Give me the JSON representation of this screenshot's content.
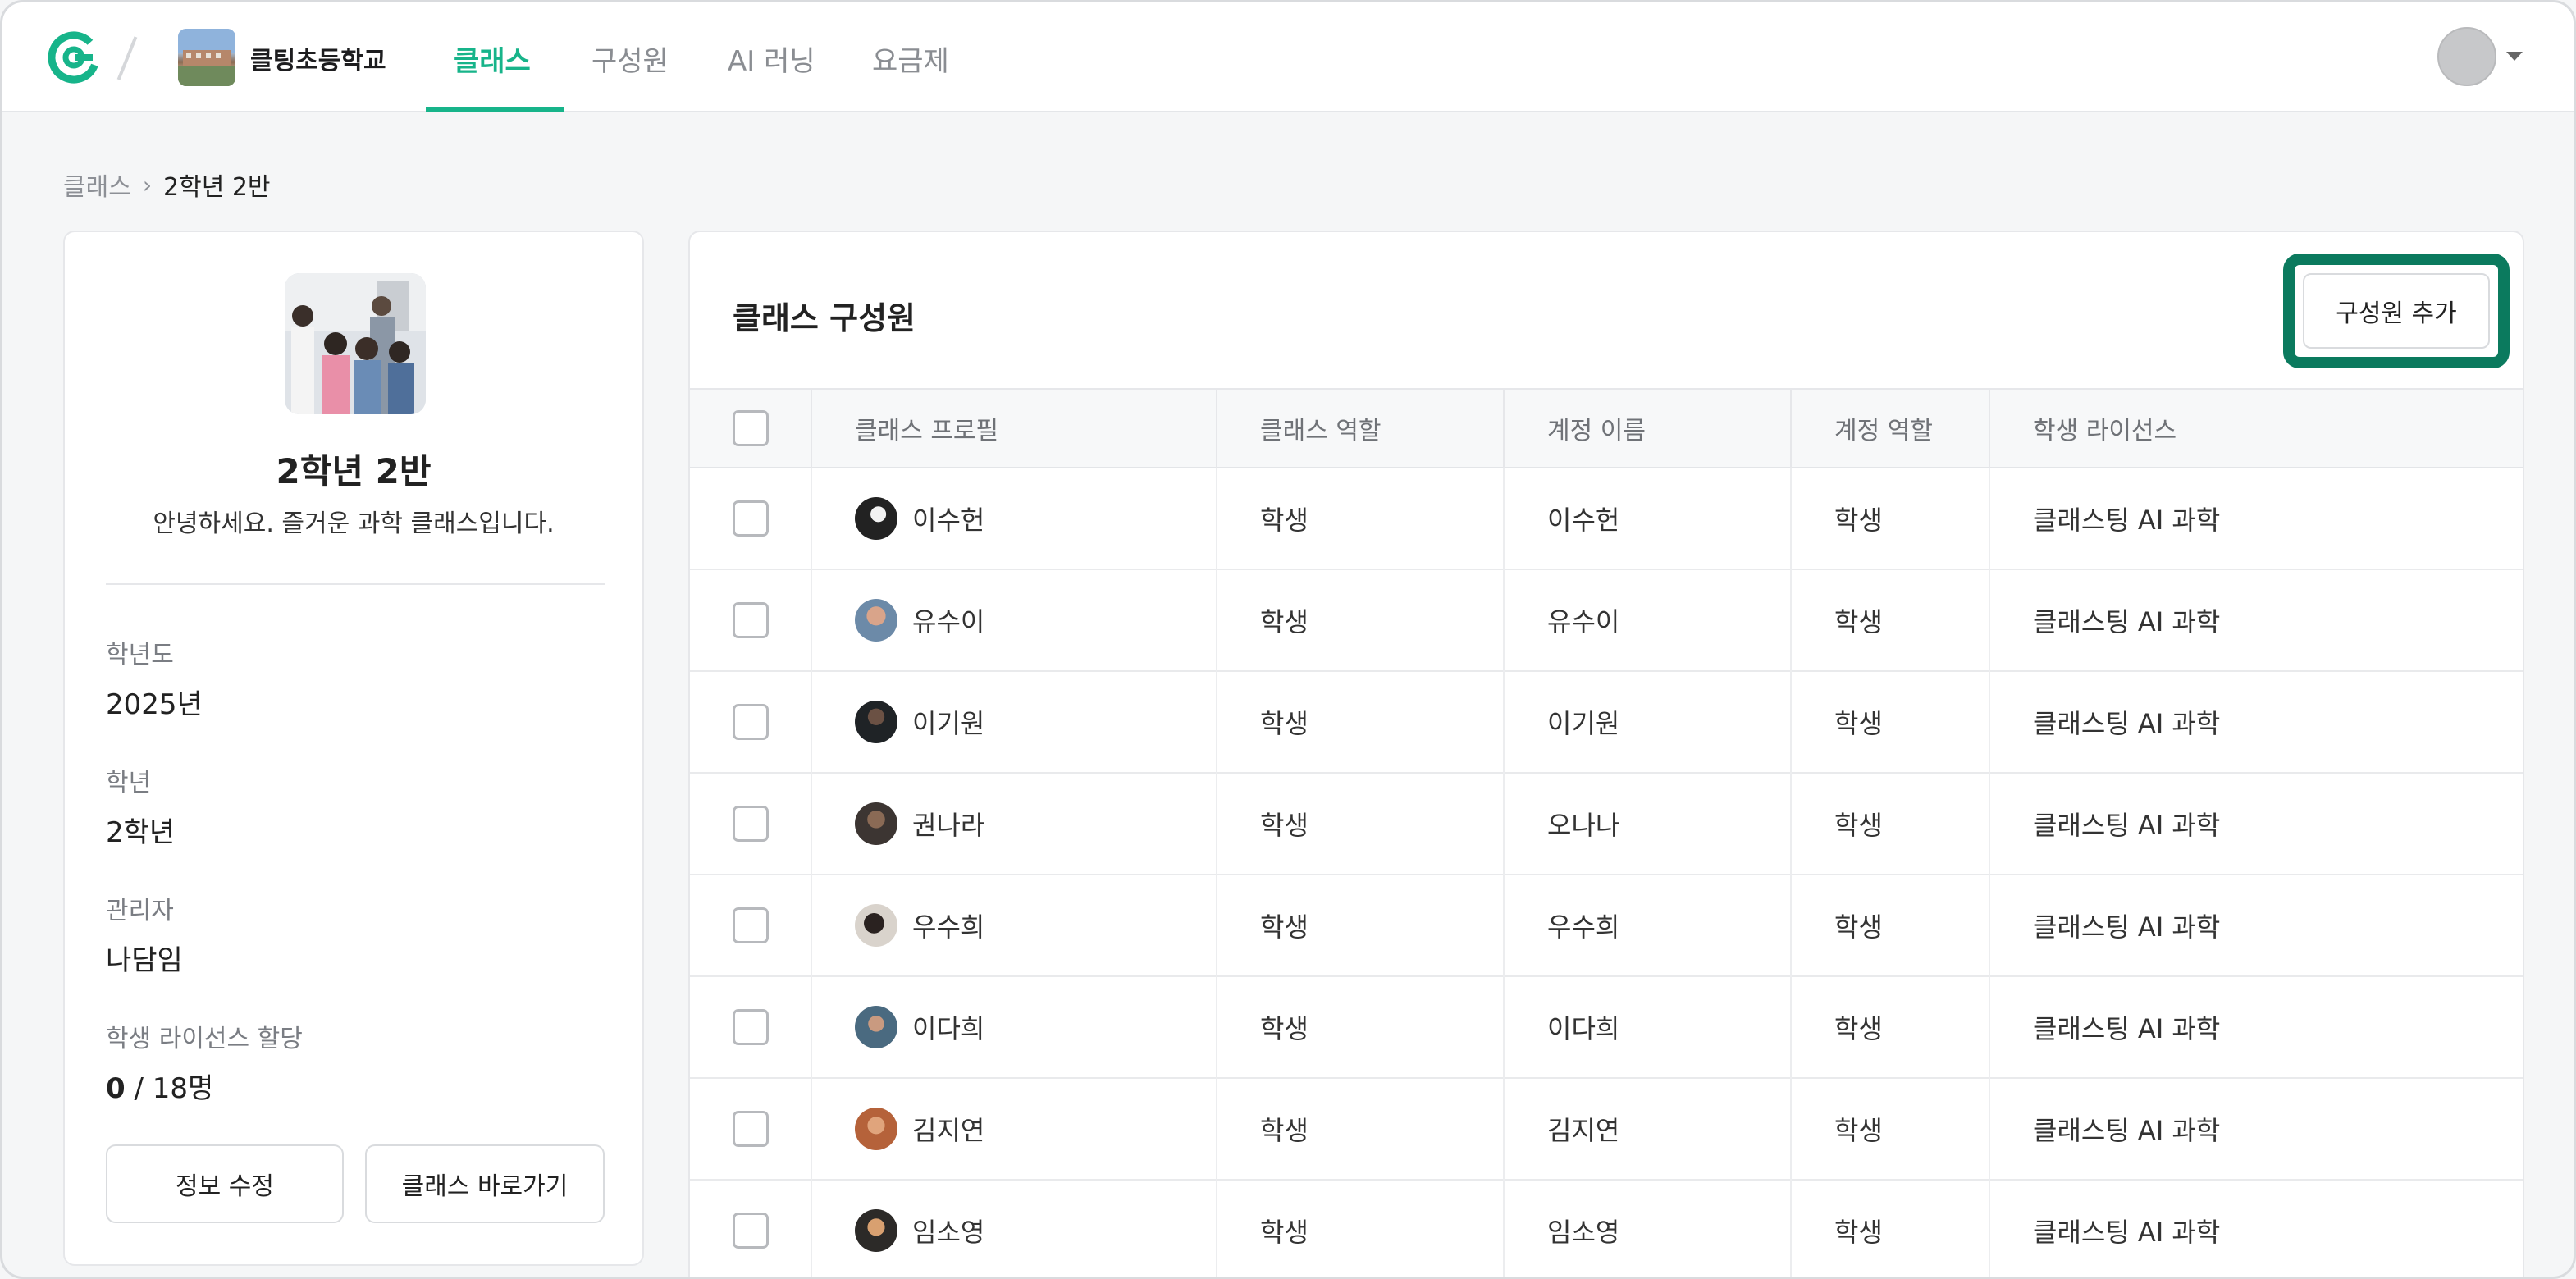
{
  "app": {
    "school_name": "클팅초등학교"
  },
  "nav": {
    "tabs": [
      {
        "label": "클래스",
        "active": true
      },
      {
        "label": "구성원",
        "active": false
      },
      {
        "label": "AI 러닝",
        "active": false
      },
      {
        "label": "요금제",
        "active": false
      }
    ],
    "accent_color": "#17b48a"
  },
  "breadcrumb": {
    "root": "클래스",
    "current": "2학년 2반"
  },
  "class_info": {
    "title": "2학년 2반",
    "description": "안녕하세요. 즐거운 과학 클래스입니다.",
    "fields": [
      {
        "label": "학년도",
        "value": "2025년"
      },
      {
        "label": "학년",
        "value": "2학년"
      },
      {
        "label": "관리자",
        "value": "나담임"
      }
    ],
    "license": {
      "label": "학생 라이선스 할당",
      "used": "0",
      "total": " / 18명"
    },
    "edit_button": "정보 수정",
    "go_button": "클래스 바로가기"
  },
  "members": {
    "title": "클래스 구성원",
    "add_button": "구성원 추가",
    "highlight_color": "#0b7a5e",
    "columns": [
      "클래스 프로필",
      "클래스 역할",
      "계정 이름",
      "계정 역할",
      "학생 라이선스"
    ],
    "rows": [
      {
        "profile": "이수헌",
        "class_role": "학생",
        "account_name": "이수헌",
        "account_role": "학생",
        "license": "클래스팅 AI 과학"
      },
      {
        "profile": "유수이",
        "class_role": "학생",
        "account_name": "유수이",
        "account_role": "학생",
        "license": "클래스팅 AI 과학"
      },
      {
        "profile": "이기원",
        "class_role": "학생",
        "account_name": "이기원",
        "account_role": "학생",
        "license": "클래스팅 AI 과학"
      },
      {
        "profile": "권나라",
        "class_role": "학생",
        "account_name": "오나나",
        "account_role": "학생",
        "license": "클래스팅 AI 과학"
      },
      {
        "profile": "우수희",
        "class_role": "학생",
        "account_name": "우수희",
        "account_role": "학생",
        "license": "클래스팅 AI 과학"
      },
      {
        "profile": "이다희",
        "class_role": "학생",
        "account_name": "이다희",
        "account_role": "학생",
        "license": "클래스팅 AI 과학"
      },
      {
        "profile": "김지연",
        "class_role": "학생",
        "account_name": "김지연",
        "account_role": "학생",
        "license": "클래스팅 AI 과학"
      },
      {
        "profile": "임소영",
        "class_role": "학생",
        "account_name": "임소영",
        "account_role": "학생",
        "license": "클래스팅 AI 과학"
      }
    ]
  }
}
